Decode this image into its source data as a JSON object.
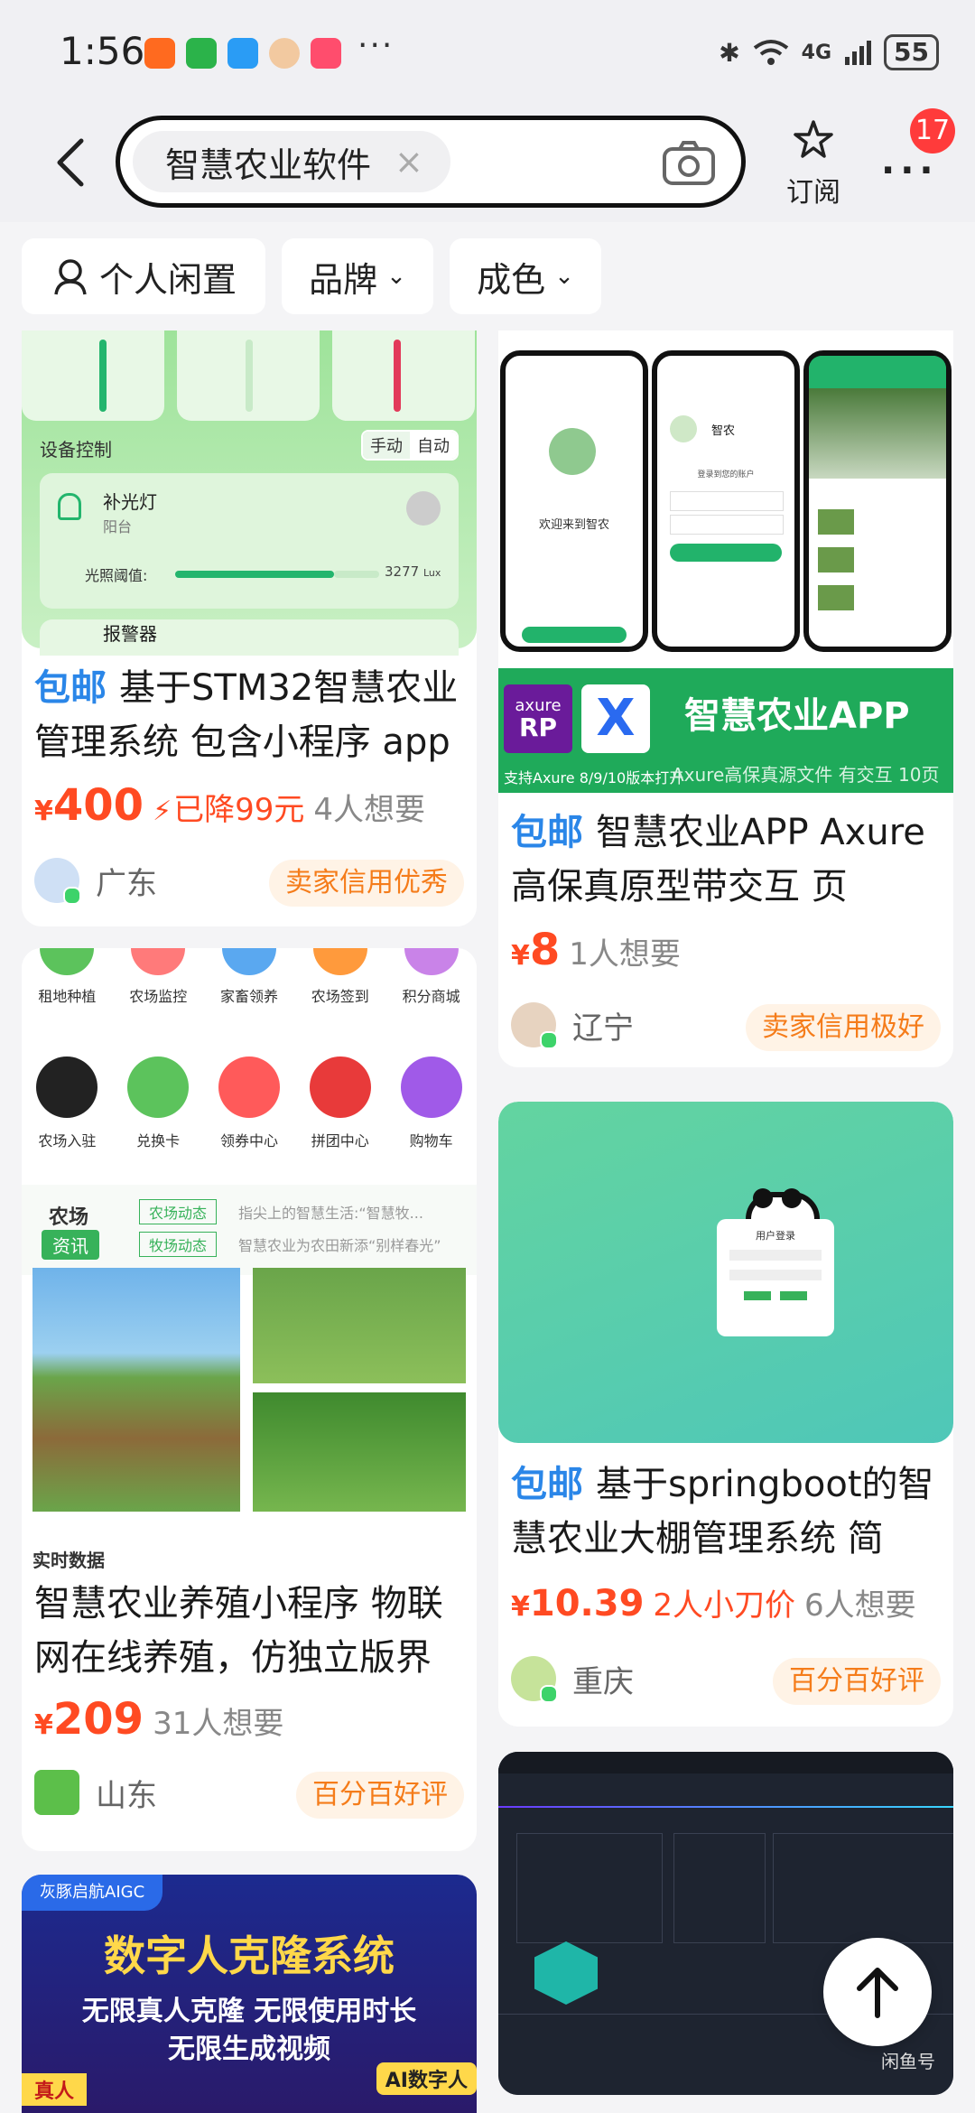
{
  "status_bar": {
    "time": "1:56",
    "more": "···",
    "network": "4G",
    "battery": "55"
  },
  "header": {
    "search_query": "智慧农业软件",
    "clear": "×",
    "subscribe_label": "订阅",
    "more": "···",
    "notification_count": "17"
  },
  "filters": [
    {
      "label": "个人闲置"
    },
    {
      "label": "品牌"
    },
    {
      "label": "成色"
    }
  ],
  "cards": [
    {
      "image_text": {
        "section": "设备控制",
        "mode_manual": "手动",
        "mode_auto": "自动",
        "device": "补光灯",
        "device_loc": "阳台",
        "threshold_label": "光照阈值:",
        "threshold_value": "3277",
        "threshold_unit": "Lux",
        "next": "报警器"
      },
      "title": "基于STM32智慧农业管理系统 包含小程序 app",
      "free_shipping": "包邮",
      "price_symbol": "¥",
      "price": "400",
      "drop": "已降99元",
      "wants": "4人想要",
      "region": "广东",
      "badge": "卖家信用优秀"
    },
    {
      "image_text": {
        "welcome": "欢迎来到智农",
        "app": "智农",
        "login": "登录到您的账户",
        "banner": "智慧农业APP",
        "axure": "axure",
        "rp": "RP",
        "support": "支持Axure 8/9/10版本打开",
        "desc": "Axure高保真源文件 有交互 10页"
      },
      "title": "智慧农业APP Axure 高保真原型带交互 页",
      "free_shipping": "包邮",
      "price_symbol": "¥",
      "price": "8",
      "wants": "1人想要",
      "region": "辽宁",
      "badge": "卖家信用极好"
    },
    {
      "image_text": {
        "icons_row1": [
          "租地种植",
          "农场监控",
          "家畜领养",
          "农场签到",
          "积分商城"
        ],
        "icons_row2": [
          "农场入驻",
          "兑换卡",
          "领券中心",
          "拼团中心",
          "购物车"
        ],
        "news_title": "农场",
        "news_sub": "资讯",
        "news_tag1": "农场动态",
        "news_tag2": "牧场动态",
        "news_line1": "指尖上的智慧生活:“智慧牧...",
        "news_line2": "智慧农业为农田新添“别样春光”",
        "realtime": "实时数据"
      },
      "title": "智慧农业养殖小程序 物联网在线养殖，仿独立版界",
      "price_symbol": "¥",
      "price": "209",
      "wants": "31人想要",
      "region": "山东",
      "badge": "百分百好评"
    },
    {
      "image_text": {
        "login_title": "用户登录"
      },
      "title": "基于springboot的智慧农业大棚管理系统 简",
      "free_shipping": "包邮",
      "price_symbol": "¥",
      "price": "10.39",
      "drop": "2人小刀价",
      "wants": "6人想要",
      "region": "重庆",
      "badge": "百分百好评"
    },
    {
      "image_text": {
        "brand": "灰豚启航AIGC",
        "headline": "数字人克隆系统",
        "line1": "无限真人克隆 无限使用时长",
        "line2": "无限生成视频",
        "real": "真人",
        "ai": "AI数字人"
      }
    },
    {
      "image_text": {
        "watermark": "闲鱼号"
      }
    }
  ],
  "colors": {
    "accent": "#ff4a22",
    "free": "#2a86e8",
    "tag_bg": "#fff3e6",
    "tag_fg": "#f57c1a"
  }
}
